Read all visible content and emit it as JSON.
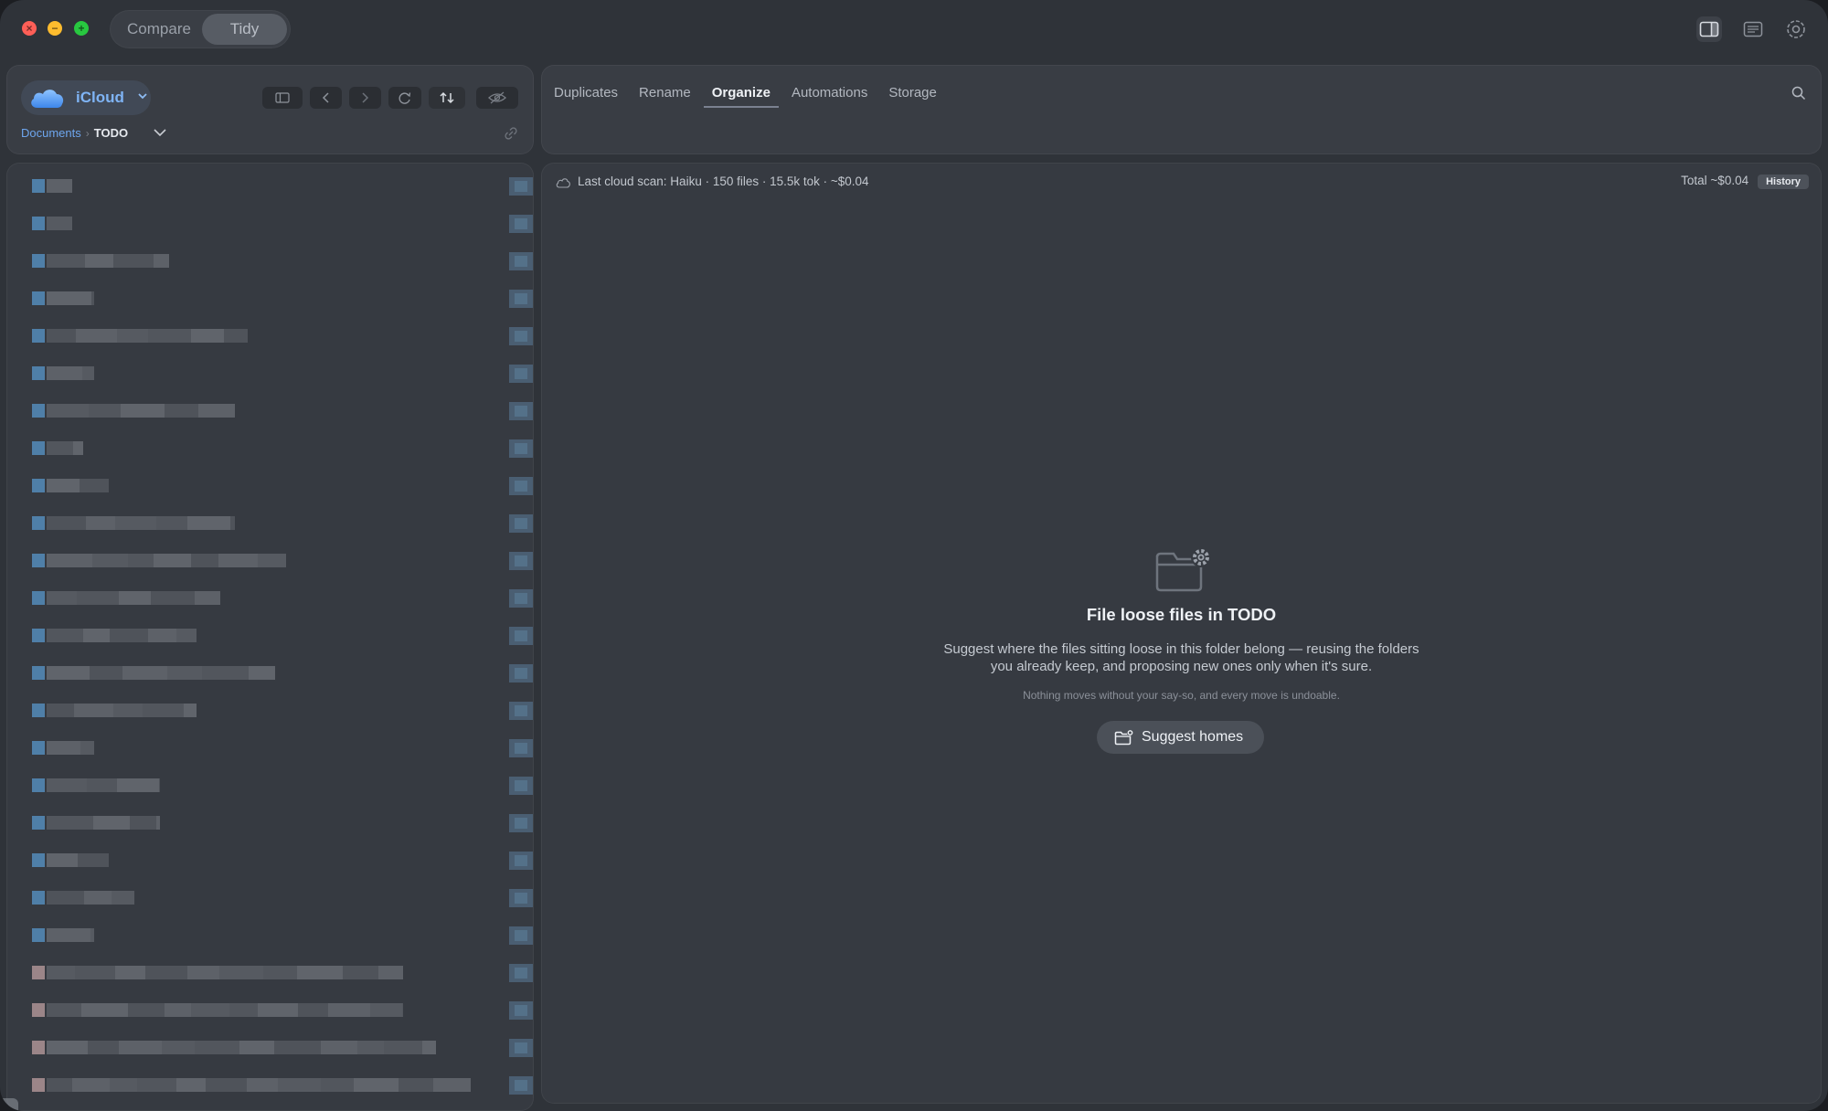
{
  "titlebar": {
    "mode_compare": "Compare",
    "mode_tidy": "Tidy",
    "active_mode": "Tidy",
    "icons": [
      "sidebar-right-icon",
      "inspector-icon",
      "settings-icon"
    ]
  },
  "navigator": {
    "location_label": "iCloud",
    "location_icon": "cloud-icon",
    "breadcrumb": {
      "root": "Documents",
      "current": "TODO"
    },
    "toolbar_icons": [
      "sidebar-toggle-icon",
      "back-icon",
      "forward-icon",
      "refresh-icon",
      "sort-icon",
      "eye-icon"
    ]
  },
  "tabs": {
    "items": [
      "Duplicates",
      "Rename",
      "Organize",
      "Automations",
      "Storage"
    ],
    "active": "Organize"
  },
  "scan": {
    "summary": "Last cloud scan: Haiku · 150 files · 15.5k tok · ~$0.04",
    "total": "Total ~$0.04",
    "history_label": "History"
  },
  "empty_state": {
    "title": "File loose files in TODO",
    "description": "Suggest where the files sitting loose in this folder belong — reusing the folders you already keep, and proposing new ones only when it's sure.",
    "note": "Nothing moves without your say-so, and every move is undoable.",
    "button_label": "Suggest homes"
  },
  "colors": {
    "accent_blue": "#7fb4f5",
    "window_bg": "#2f3339",
    "panel_bg": "#393d44"
  }
}
